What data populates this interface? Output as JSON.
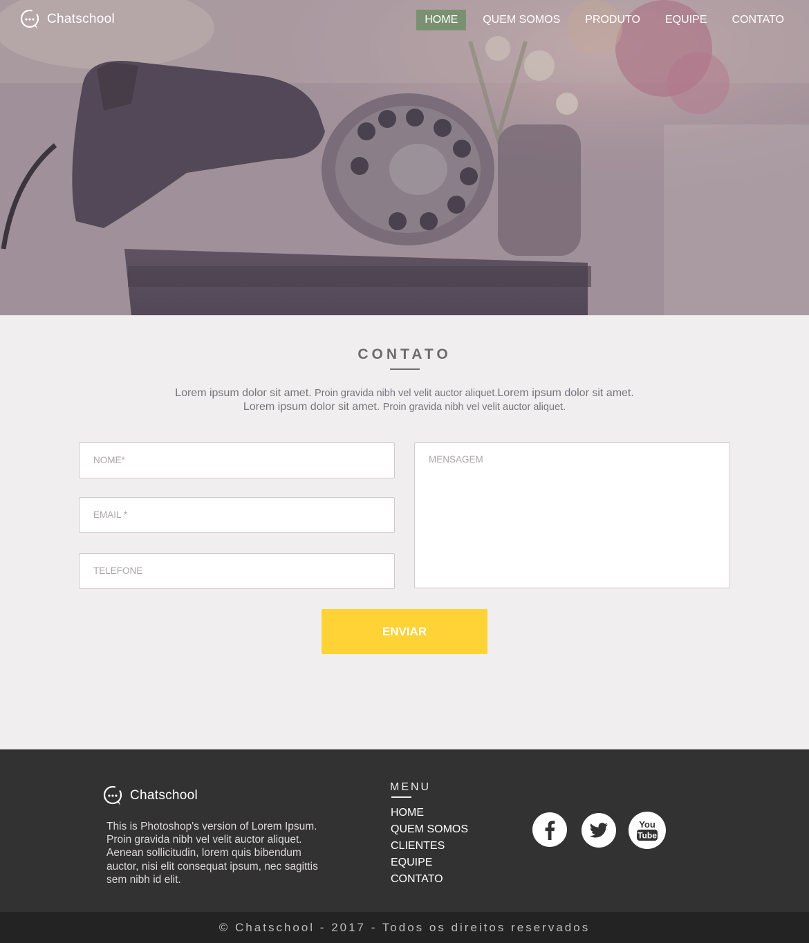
{
  "colors": {
    "accent_button": "#ffd235",
    "active_nav": "#688c60",
    "footer_bg": "#333232",
    "bottom_bar_bg": "#242323",
    "page_bg": "#f1eeef"
  },
  "header": {
    "brand": "Chatschool",
    "brand_icon": "chat-bubble-icon",
    "nav": [
      {
        "label": "HOME",
        "active": true
      },
      {
        "label": "QUEM SOMOS",
        "active": false
      },
      {
        "label": "PRODUTO",
        "active": false
      },
      {
        "label": "EQUIPE",
        "active": false
      },
      {
        "label": "CONTATO",
        "active": false
      }
    ]
  },
  "contact": {
    "title": "CONTATO",
    "intro_line1_a": "Lorem ipsum dolor sit amet. ",
    "intro_line1_b": "Proin gravida nibh vel velit auctor aliquet.",
    "intro_line1_c": "Lorem ipsum dolor sit amet.",
    "intro_line2_a": "Lorem ipsum dolor sit amet. ",
    "intro_line2_b": "Proin gravida nibh vel velit auctor aliquet.",
    "form": {
      "name_placeholder": "NOME*",
      "email_placeholder": "EMAIL *",
      "phone_placeholder": "TELEFONE",
      "message_placeholder": "MENSAGEM",
      "submit_label": "ENVIAR"
    }
  },
  "footer": {
    "brand": "Chatschool",
    "about": "This is Photoshop's version  of Lorem Ipsum. Proin gravida nibh vel velit auctor aliquet. Aenean sollicitudin, lorem quis bibendum auctor, nisi elit consequat ipsum, nec sagittis sem nibh id elit.",
    "menu_title": "MENU",
    "menu": [
      "HOME",
      "QUEM SOMOS",
      "CLIENTES",
      "EQUIPE",
      "CONTATO"
    ],
    "social": [
      "facebook-icon",
      "twitter-icon",
      "youtube-icon"
    ],
    "copyright": "© Chatschool - 2017 - Todos os direitos reservados"
  }
}
